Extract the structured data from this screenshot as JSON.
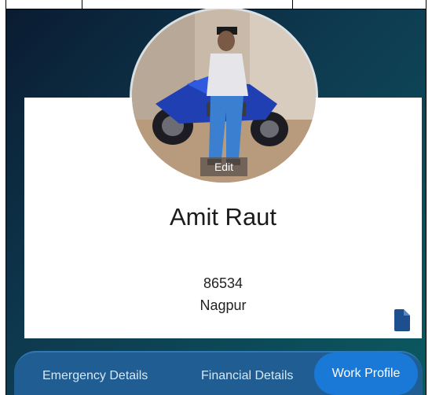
{
  "profile": {
    "name": "Amit Raut",
    "employee_id": "86534",
    "city": "Nagpur",
    "edit_label": "Edit",
    "avatar_icon": "profile-photo",
    "document_icon": "document-icon"
  },
  "tabs": [
    {
      "label": "Emergency Details",
      "active": false
    },
    {
      "label": "Financial Details",
      "active": false
    },
    {
      "label": "Work Profile",
      "active": true
    }
  ],
  "colors": {
    "tabbar": "#1f5d92",
    "active_tab": "#1a78d6",
    "doc_icon": "#1d4f8e"
  }
}
